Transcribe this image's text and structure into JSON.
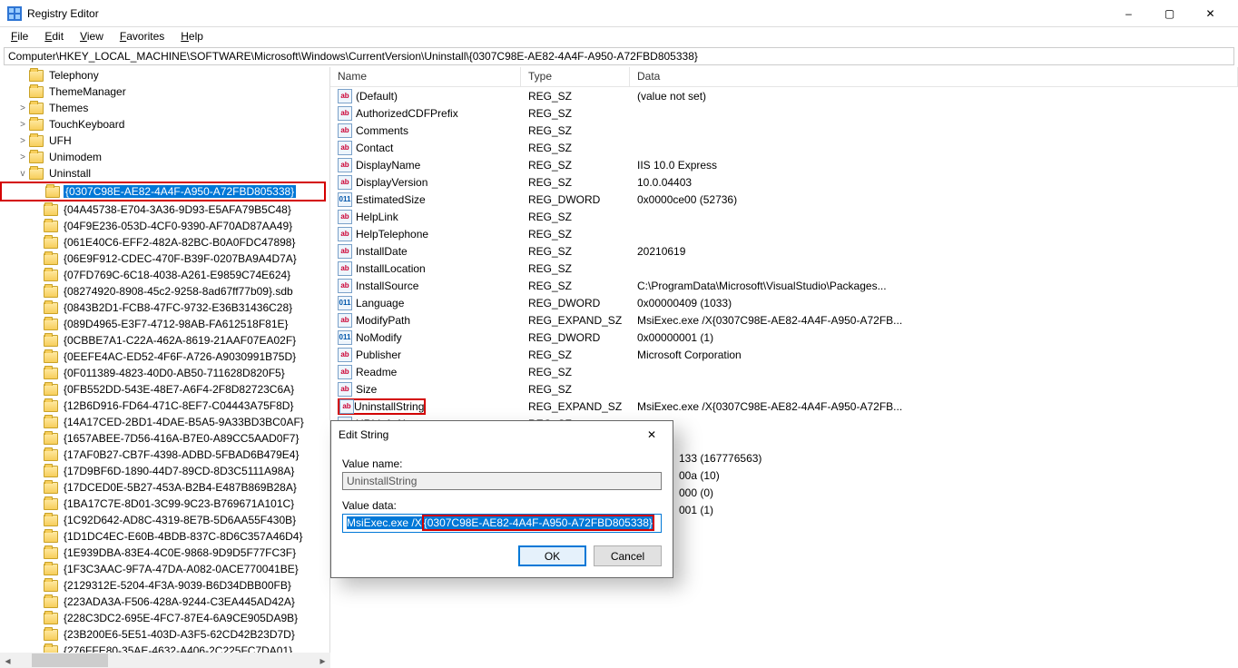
{
  "window": {
    "title": "Registry Editor",
    "minimize": "–",
    "maximize": "▢",
    "close": "✕"
  },
  "menu": [
    "File",
    "Edit",
    "View",
    "Favorites",
    "Help"
  ],
  "address": "Computer\\HKEY_LOCAL_MACHINE\\SOFTWARE\\Microsoft\\Windows\\CurrentVersion\\Uninstall\\{0307C98E-AE82-4A4F-A950-A72FBD805338}",
  "tree": [
    {
      "indent": 1,
      "label": "Telephony"
    },
    {
      "indent": 1,
      "label": "ThemeManager"
    },
    {
      "indent": 1,
      "label": "Themes",
      "twisty": ">"
    },
    {
      "indent": 1,
      "label": "TouchKeyboard",
      "twisty": ">"
    },
    {
      "indent": 1,
      "label": "UFH",
      "twisty": ">"
    },
    {
      "indent": 1,
      "label": "Unimodem",
      "twisty": ">"
    },
    {
      "indent": 1,
      "label": "Uninstall",
      "twisty": "v"
    },
    {
      "indent": 2,
      "label": "{0307C98E-AE82-4A4F-A950-A72FBD805338}",
      "selected": true,
      "redbox": true
    },
    {
      "indent": 2,
      "label": "{04A45738-E704-3A36-9D93-E5AFA79B5C48}"
    },
    {
      "indent": 2,
      "label": "{04F9E236-053D-4CF0-9390-AF70AD87AA49}"
    },
    {
      "indent": 2,
      "label": "{061E40C6-EFF2-482A-82BC-B0A0FDC47898}"
    },
    {
      "indent": 2,
      "label": "{06E9F912-CDEC-470F-B39F-0207BA9A4D7A}"
    },
    {
      "indent": 2,
      "label": "{07FD769C-6C18-4038-A261-E9859C74E624}"
    },
    {
      "indent": 2,
      "label": "{08274920-8908-45c2-9258-8ad67ff77b09}.sdb"
    },
    {
      "indent": 2,
      "label": "{0843B2D1-FCB8-47FC-9732-E36B31436C28}"
    },
    {
      "indent": 2,
      "label": "{089D4965-E3F7-4712-98AB-FA612518F81E}"
    },
    {
      "indent": 2,
      "label": "{0CBBE7A1-C22A-462A-8619-21AAF07EA02F}"
    },
    {
      "indent": 2,
      "label": "{0EEFE4AC-ED52-4F6F-A726-A9030991B75D}"
    },
    {
      "indent": 2,
      "label": "{0F011389-4823-40D0-AB50-711628D820F5}"
    },
    {
      "indent": 2,
      "label": "{0FB552DD-543E-48E7-A6F4-2F8D82723C6A}"
    },
    {
      "indent": 2,
      "label": "{12B6D916-FD64-471C-8EF7-C04443A75F8D}"
    },
    {
      "indent": 2,
      "label": "{14A17CED-2BD1-4DAE-B5A5-9A33BD3BC0AF}"
    },
    {
      "indent": 2,
      "label": "{1657ABEE-7D56-416A-B7E0-A89CC5AAD0F7}"
    },
    {
      "indent": 2,
      "label": "{17AF0B27-CB7F-4398-ADBD-5FBAD6B479E4}"
    },
    {
      "indent": 2,
      "label": "{17D9BF6D-1890-44D7-89CD-8D3C5111A98A}"
    },
    {
      "indent": 2,
      "label": "{17DCED0E-5B27-453A-B2B4-E487B869B28A}"
    },
    {
      "indent": 2,
      "label": "{1BA17C7E-8D01-3C99-9C23-B769671A101C}"
    },
    {
      "indent": 2,
      "label": "{1C92D642-AD8C-4319-8E7B-5D6AA55F430B}"
    },
    {
      "indent": 2,
      "label": "{1D1DC4EC-E60B-4BDB-837C-8D6C357A46D4}"
    },
    {
      "indent": 2,
      "label": "{1E939DBA-83E4-4C0E-9868-9D9D5F77FC3F}"
    },
    {
      "indent": 2,
      "label": "{1F3C3AAC-9F7A-47DA-A082-0ACE770041BE}"
    },
    {
      "indent": 2,
      "label": "{2129312E-5204-4F3A-9039-B6D34DBB00FB}"
    },
    {
      "indent": 2,
      "label": "{223ADA3A-F506-428A-9244-C3EA445AD42A}"
    },
    {
      "indent": 2,
      "label": "{228C3DC2-695E-4FC7-87E4-6A9CE905DA9B}"
    },
    {
      "indent": 2,
      "label": "{23B200E6-5E51-403D-A3F5-62CD42B23D7D}"
    },
    {
      "indent": 2,
      "label": "{276FFE80-35AE-4632-A406-2C225FC7DA01}"
    }
  ],
  "columns": {
    "name": "Name",
    "type": "Type",
    "data": "Data"
  },
  "values": [
    {
      "icon": "sz",
      "name": "(Default)",
      "type": "REG_SZ",
      "data": "(value not set)"
    },
    {
      "icon": "sz",
      "name": "AuthorizedCDFPrefix",
      "type": "REG_SZ",
      "data": ""
    },
    {
      "icon": "sz",
      "name": "Comments",
      "type": "REG_SZ",
      "data": ""
    },
    {
      "icon": "sz",
      "name": "Contact",
      "type": "REG_SZ",
      "data": ""
    },
    {
      "icon": "sz",
      "name": "DisplayName",
      "type": "REG_SZ",
      "data": "IIS 10.0 Express"
    },
    {
      "icon": "sz",
      "name": "DisplayVersion",
      "type": "REG_SZ",
      "data": "10.0.04403"
    },
    {
      "icon": "dw",
      "name": "EstimatedSize",
      "type": "REG_DWORD",
      "data": "0x0000ce00 (52736)"
    },
    {
      "icon": "sz",
      "name": "HelpLink",
      "type": "REG_SZ",
      "data": ""
    },
    {
      "icon": "sz",
      "name": "HelpTelephone",
      "type": "REG_SZ",
      "data": ""
    },
    {
      "icon": "sz",
      "name": "InstallDate",
      "type": "REG_SZ",
      "data": "20210619"
    },
    {
      "icon": "sz",
      "name": "InstallLocation",
      "type": "REG_SZ",
      "data": ""
    },
    {
      "icon": "sz",
      "name": "InstallSource",
      "type": "REG_SZ",
      "data": "C:\\ProgramData\\Microsoft\\VisualStudio\\Packages..."
    },
    {
      "icon": "dw",
      "name": "Language",
      "type": "REG_DWORD",
      "data": "0x00000409 (1033)"
    },
    {
      "icon": "sz",
      "name": "ModifyPath",
      "type": "REG_EXPAND_SZ",
      "data": "MsiExec.exe /X{0307C98E-AE82-4A4F-A950-A72FB..."
    },
    {
      "icon": "dw",
      "name": "NoModify",
      "type": "REG_DWORD",
      "data": "0x00000001 (1)"
    },
    {
      "icon": "sz",
      "name": "Publisher",
      "type": "REG_SZ",
      "data": "Microsoft Corporation"
    },
    {
      "icon": "sz",
      "name": "Readme",
      "type": "REG_SZ",
      "data": ""
    },
    {
      "icon": "sz",
      "name": "Size",
      "type": "REG_SZ",
      "data": ""
    },
    {
      "icon": "sz",
      "name": "UninstallString",
      "type": "REG_EXPAND_SZ",
      "data": "MsiExec.exe /X{0307C98E-AE82-4A4F-A950-A72FB...",
      "redbox": true
    },
    {
      "icon": "sz",
      "name": "URLInfoAbout",
      "type": "REG_SZ",
      "data": ""
    }
  ],
  "partial_data_below_dialog": [
    "133 (167776563)",
    "00a (10)",
    "000 (0)",
    "001 (1)"
  ],
  "dialog": {
    "title": "Edit String",
    "value_name_label": "Value name:",
    "value_name": "UninstallString",
    "value_data_label": "Value data:",
    "value_data_prefix": "MsiExec.exe /X",
    "value_data_guid_open": "{",
    "value_data_guid_body": "0307C98E-AE82-4A4F-A950-A72FBD805338",
    "value_data_guid_close": "}",
    "ok": "OK",
    "cancel": "Cancel",
    "close": "✕"
  }
}
